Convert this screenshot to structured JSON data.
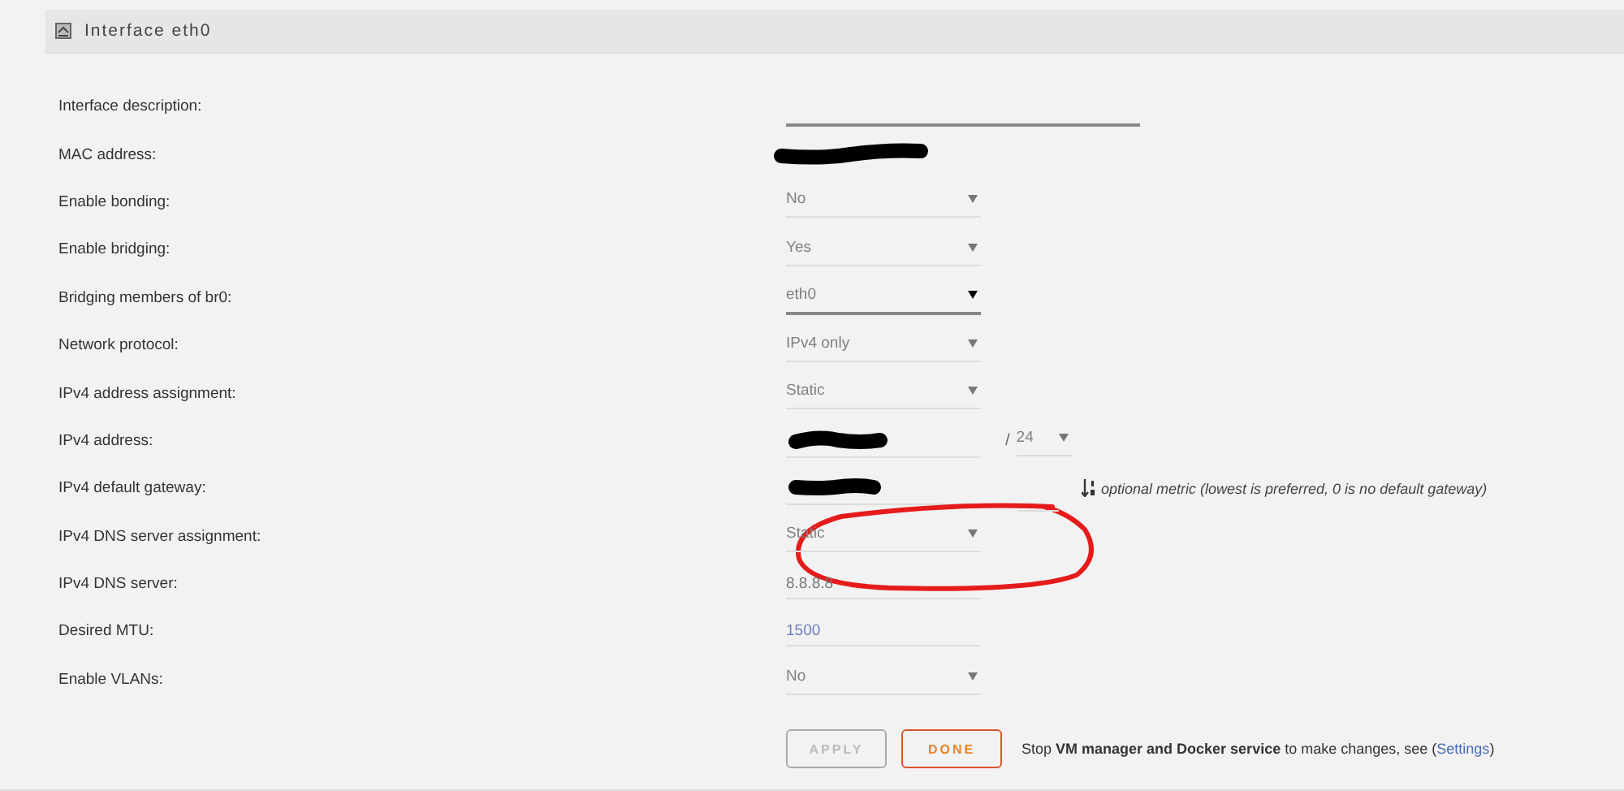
{
  "panel": {
    "title": "Interface eth0"
  },
  "rows": [
    {
      "label": "Interface description:",
      "kind": "text",
      "value": ""
    },
    {
      "label": "MAC address:",
      "kind": "static",
      "redacted": true
    },
    {
      "label": "Enable bonding:",
      "kind": "select",
      "value": "No",
      "focused": false
    },
    {
      "label": "Enable bridging:",
      "kind": "select",
      "value": "Yes",
      "focused": false
    },
    {
      "label": "Bridging members of br0:",
      "kind": "select",
      "value": "eth0",
      "focused": true
    },
    {
      "label": "Network protocol:",
      "kind": "select",
      "value": "IPv4 only",
      "focused": false
    },
    {
      "label": "IPv4 address assignment:",
      "kind": "select",
      "value": "Static",
      "focused": false
    },
    {
      "label": "IPv4 address:",
      "kind": "address",
      "redacted": true,
      "separator": "/",
      "mask": "24"
    },
    {
      "label": "IPv4 default gateway:",
      "kind": "gateway",
      "redacted": true,
      "note": "optional metric (lowest is preferred, 0 is no default gateway)"
    },
    {
      "label": "IPv4 DNS server assignment:",
      "kind": "select",
      "value": "Static",
      "focused": false
    },
    {
      "label": "IPv4 DNS server:",
      "kind": "text",
      "value": "8.8.8.8"
    },
    {
      "label": "Desired MTU:",
      "kind": "text",
      "placeholder": "1500"
    },
    {
      "label": "Enable VLANs:",
      "kind": "select",
      "value": "No",
      "focused": false
    }
  ],
  "buttons": [
    {
      "label": "APPLY",
      "disabled": true
    },
    {
      "label": "DONE",
      "disabled": false
    }
  ],
  "notice": {
    "text": "Stop **VM manager and Docker service** to make changes, see (",
    "link": "Settings",
    "end": ")"
  },
  "annotations": [
    {
      "kind": "freehand-circle"
    }
  ]
}
